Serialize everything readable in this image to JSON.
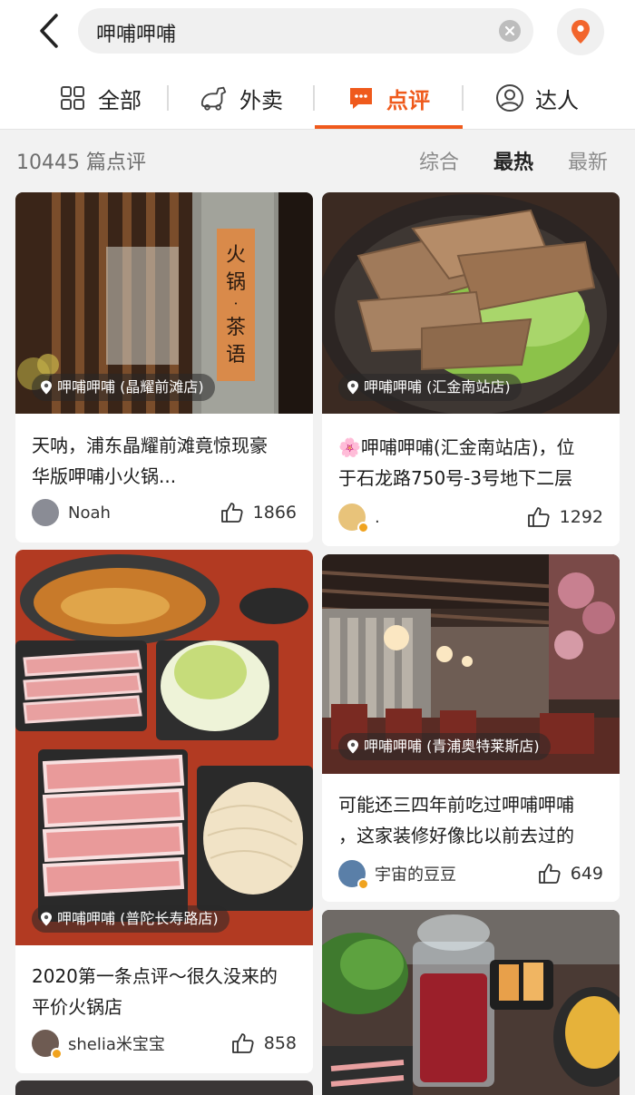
{
  "search": {
    "query": "呷哺呷哺"
  },
  "tabs": [
    {
      "label": "全部",
      "icon": "grid-icon"
    },
    {
      "label": "外卖",
      "icon": "delivery-icon"
    },
    {
      "label": "点评",
      "icon": "comment-icon",
      "active": true
    },
    {
      "label": "达人",
      "icon": "user-icon"
    }
  ],
  "sortbar": {
    "count_text": "10445 篇点评",
    "options": [
      "综合",
      "最热",
      "最新"
    ],
    "active": "最热"
  },
  "colors": {
    "accent": "#ef5a1c",
    "badge": "#f0a31f"
  },
  "cards": [
    {
      "shop_tag": "呷哺呷哺 (晶耀前滩店)",
      "title_line1": "天呐，浦东晶耀前滩竟惊现豪",
      "title_line2": "华版呷哺小火锅...",
      "author": "Noah",
      "likes": "1866",
      "sign_text": "火锅·茶语"
    },
    {
      "shop_tag": "呷哺呷哺 (汇金南站店)",
      "title_line1": "🌸呷哺呷哺(汇金南站店)，位",
      "title_line2": "于石龙路750号-3号地下二层",
      "author": ".",
      "likes": "1292"
    },
    {
      "shop_tag": "呷哺呷哺 (普陀长寿路店)",
      "title_line1": "2020第一条点评～很久没来的",
      "title_line2": "平价火锅店",
      "author": "shelia米宝宝",
      "likes": "858"
    },
    {
      "shop_tag": "呷哺呷哺 (青浦奥特莱斯店)",
      "title_line1": "可能还三四年前吃过呷哺呷哺",
      "title_line2": "，这家装修好像比以前去过的",
      "author": "宇宙的豆豆",
      "likes": "649"
    }
  ]
}
